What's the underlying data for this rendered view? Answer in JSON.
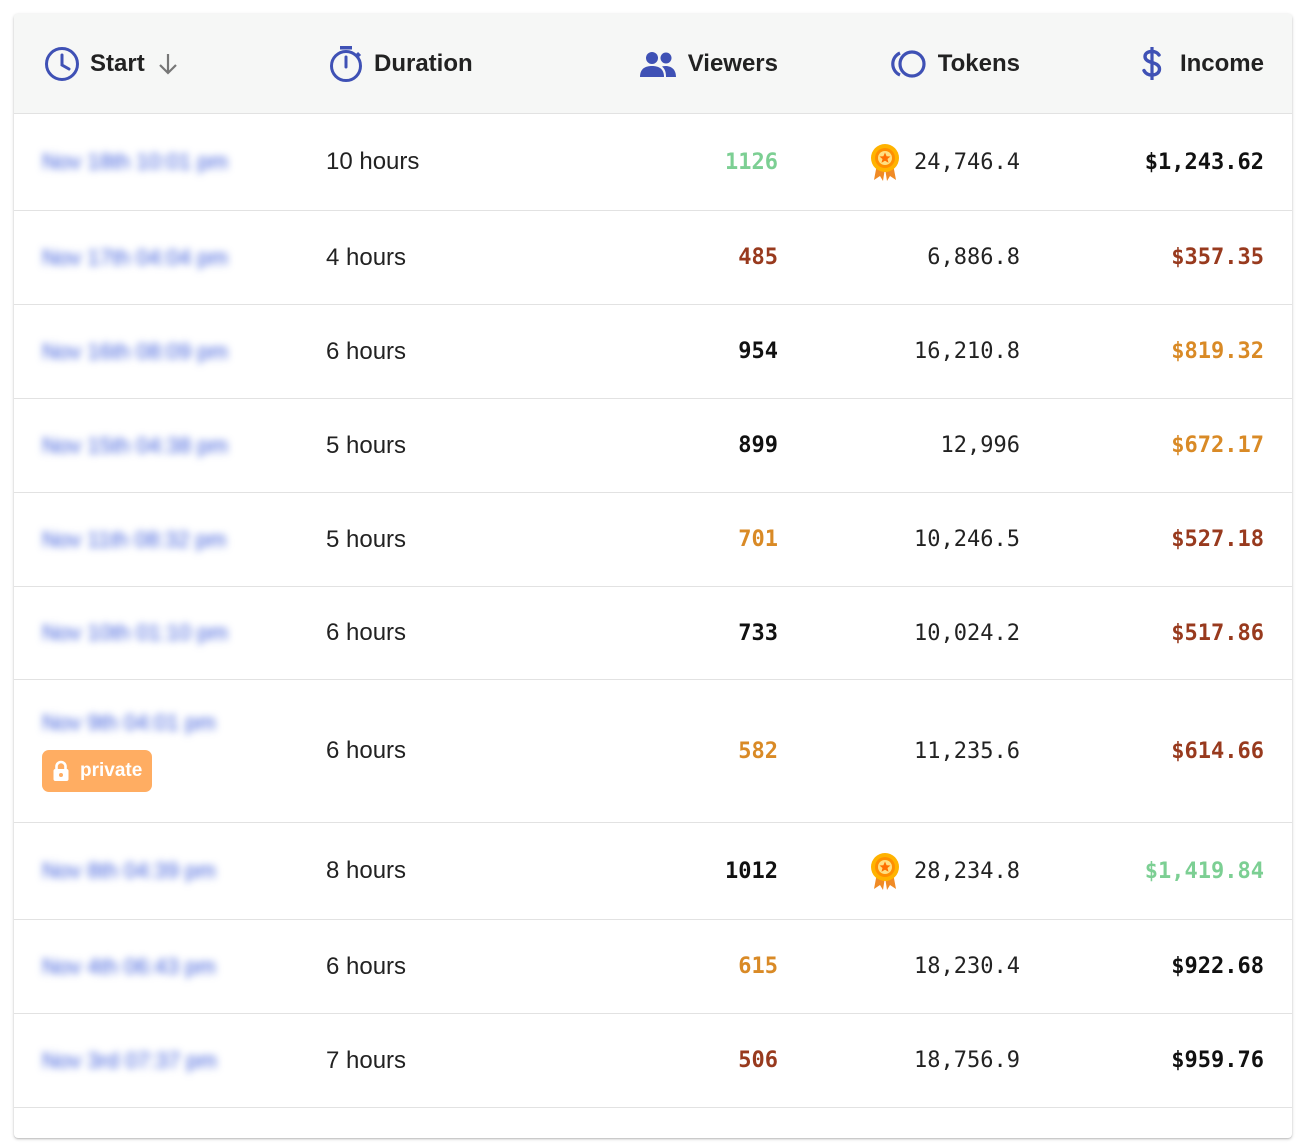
{
  "colors": {
    "icon_blue": "#3f51b5",
    "green": "#7ccf93",
    "orange": "#d98a26",
    "brown": "#983a1e",
    "black": "#111111",
    "private_badge": "#ffad62"
  },
  "header": {
    "start": "Start",
    "duration": "Duration",
    "viewers": "Viewers",
    "tokens": "Tokens",
    "income": "Income",
    "icons": [
      "clock-icon",
      "stopwatch-icon",
      "people-icon",
      "coins-icon",
      "dollar-icon",
      "arrow-down-icon"
    ]
  },
  "rows": [
    {
      "start": "Nov 18th 10:01 pm",
      "duration": "10 hours",
      "viewers": "1126",
      "viewers_color": "#7ccf93",
      "tokens": "24,746.4",
      "medal": true,
      "income": "$1,243.62",
      "income_color": "#111111"
    },
    {
      "start": "Nov 17th 04:04 pm",
      "duration": "4 hours",
      "viewers": "485",
      "viewers_color": "#983a1e",
      "tokens": "6,886.8",
      "medal": false,
      "income": "$357.35",
      "income_color": "#983a1e"
    },
    {
      "start": "Nov 16th 08:09 pm",
      "duration": "6 hours",
      "viewers": "954",
      "viewers_color": "#111111",
      "tokens": "16,210.8",
      "medal": false,
      "income": "$819.32",
      "income_color": "#d98a26"
    },
    {
      "start": "Nov 15th 04:38 pm",
      "duration": "5 hours",
      "viewers": "899",
      "viewers_color": "#111111",
      "tokens": "12,996",
      "medal": false,
      "income": "$672.17",
      "income_color": "#d98a26"
    },
    {
      "start": "Nov 11th 08:32 pm",
      "duration": "5 hours",
      "viewers": "701",
      "viewers_color": "#d98a26",
      "tokens": "10,246.5",
      "medal": false,
      "income": "$527.18",
      "income_color": "#983a1e"
    },
    {
      "start": "Nov 10th 01:10 pm",
      "duration": "6 hours",
      "viewers": "733",
      "viewers_color": "#111111",
      "tokens": "10,024.2",
      "medal": false,
      "income": "$517.86",
      "income_color": "#983a1e"
    },
    {
      "start": "Nov 9th 04:01 pm",
      "duration": "6 hours",
      "viewers": "582",
      "viewers_color": "#d98a26",
      "tokens": "11,235.6",
      "medal": false,
      "income": "$614.66",
      "income_color": "#983a1e",
      "private": "private"
    },
    {
      "start": "Nov 8th 04:39 pm",
      "duration": "8 hours",
      "viewers": "1012",
      "viewers_color": "#111111",
      "tokens": "28,234.8",
      "medal": true,
      "income": "$1,419.84",
      "income_color": "#7ccf93"
    },
    {
      "start": "Nov 4th 06:43 pm",
      "duration": "6 hours",
      "viewers": "615",
      "viewers_color": "#d98a26",
      "tokens": "18,230.4",
      "medal": false,
      "income": "$922.68",
      "income_color": "#111111"
    },
    {
      "start": "Nov 3rd 07:37 pm",
      "duration": "7 hours",
      "viewers": "506",
      "viewers_color": "#983a1e",
      "tokens": "18,756.9",
      "medal": false,
      "income": "$959.76",
      "income_color": "#111111"
    }
  ]
}
